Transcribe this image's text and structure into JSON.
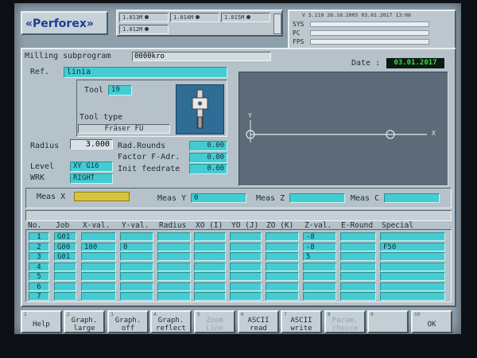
{
  "brand": {
    "logo_text": "Perforex",
    "arrow_left": "«",
    "arrow_right": "»"
  },
  "memory_slots": [
    {
      "label": "1.013M"
    },
    {
      "label": "1.014M"
    },
    {
      "label": "1.015M"
    },
    {
      "label": "1.012M"
    }
  ],
  "status": {
    "version": "V 5.110 26.10.2005",
    "date": "03.01.2017",
    "time": "13:06"
  },
  "flags": [
    {
      "label": "SYS"
    },
    {
      "label": "PC"
    },
    {
      "label": "FPS"
    }
  ],
  "header": {
    "title": "Milling subprogram",
    "program_name": "0000kro",
    "date_label": "Date :",
    "date_value": "03.01.2017"
  },
  "form": {
    "ref_label": "Ref.",
    "ref_value": "linia",
    "tool_label": "Tool",
    "tool_value": "19",
    "tool_type_label": "Tool type",
    "tool_type_value": "Fräser  FU",
    "radius_label": "Radius",
    "radius_value": "3.000",
    "rad_rounds_label": "Rad.Rounds",
    "rad_rounds_value": "0.00",
    "factor_label": "Factor F-Adr.",
    "factor_value": "0.00",
    "init_feed_label": "Init feedrate",
    "init_feed_value": "0.00",
    "level_label": "Level",
    "level_value": "XY G16",
    "wrk_label": "WRK",
    "wrk_value": "RIGHT"
  },
  "preview": {
    "y_axis": "Y",
    "x_axis": "X"
  },
  "meas": [
    {
      "label": "Meas X",
      "value": ""
    },
    {
      "label": "Meas Y",
      "value": "0"
    },
    {
      "label": "Meas Z",
      "value": ""
    },
    {
      "label": "Meas C",
      "value": ""
    }
  ],
  "table": {
    "columns": [
      "No.",
      "Job",
      "X-val.",
      "Y-val.",
      "Radius",
      "XO (I)",
      "YO (J)",
      "ZO (K)",
      "Z-val.",
      "E-Round",
      "Special"
    ],
    "rows": [
      [
        "1",
        "G01",
        "",
        "",
        "",
        "",
        "",
        "",
        "-8",
        "",
        ""
      ],
      [
        "2",
        "G00",
        "100",
        "0",
        "",
        "",
        "",
        "",
        "-8",
        "",
        "F50"
      ],
      [
        "3",
        "G01",
        "",
        "",
        "",
        "",
        "",
        "",
        "5",
        "",
        ""
      ],
      [
        "4",
        "",
        "",
        "",
        "",
        "",
        "",
        "",
        "",
        "",
        ""
      ],
      [
        "5",
        "",
        "",
        "",
        "",
        "",
        "",
        "",
        "",
        "",
        ""
      ],
      [
        "6",
        "",
        "",
        "",
        "",
        "",
        "",
        "",
        "",
        "",
        ""
      ],
      [
        "7",
        "",
        "",
        "",
        "",
        "",
        "",
        "",
        "",
        "",
        ""
      ]
    ]
  },
  "fkeys": [
    {
      "num": "1",
      "label": "Help",
      "enabled": true
    },
    {
      "num": "2",
      "label": "Graph.\nlarge",
      "enabled": true
    },
    {
      "num": "3",
      "label": "Graph.\noff",
      "enabled": true
    },
    {
      "num": "4",
      "label": "Graph.\nreflect",
      "enabled": true
    },
    {
      "num": "5",
      "label": "Zoom\nLine",
      "enabled": false
    },
    {
      "num": "6",
      "label": "ASCII\nread",
      "enabled": true
    },
    {
      "num": "7",
      "label": "ASCII\nwrite",
      "enabled": true
    },
    {
      "num": "8",
      "label": "Param.\nchoice",
      "enabled": false
    },
    {
      "num": "9",
      "label": "",
      "enabled": false
    },
    {
      "num": "10",
      "label": "OK",
      "enabled": true
    }
  ],
  "colors": {
    "cyan": "#43ccd2",
    "green_field": "#10d040",
    "yellow_field": "#d8c43a",
    "preview_bg": "#5c6b77"
  }
}
